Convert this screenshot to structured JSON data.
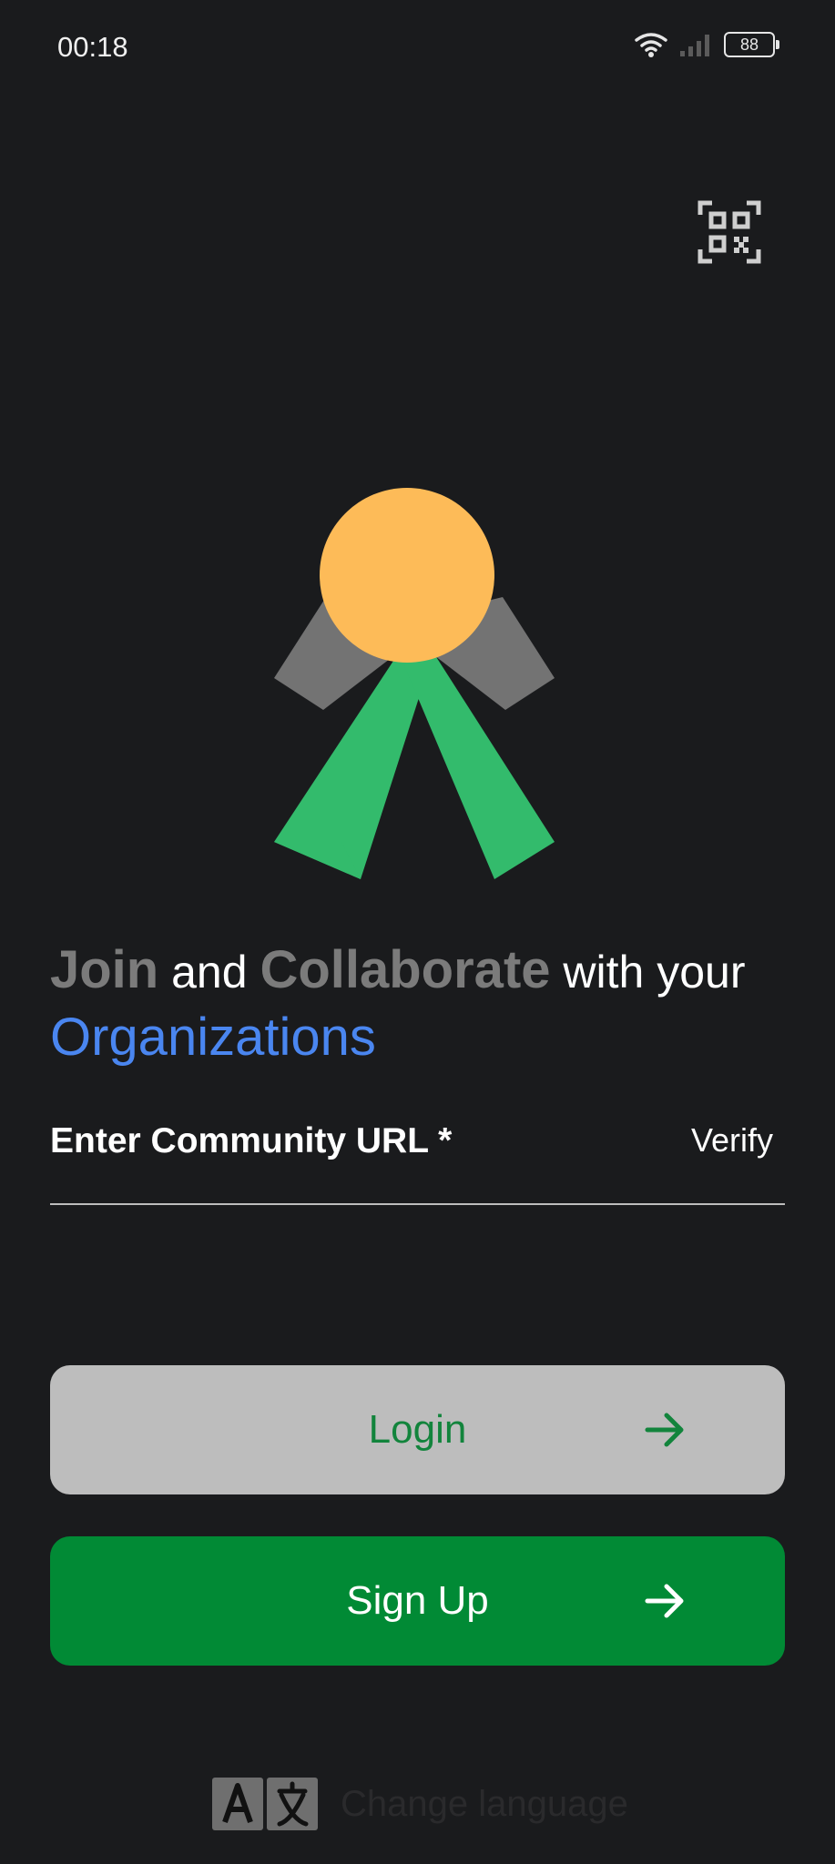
{
  "status_bar": {
    "time": "00:18",
    "battery": "88"
  },
  "headline": {
    "part1": "Join",
    "part2": " and ",
    "part3": "Collaborate",
    "part4": " with your",
    "part5": "Organizations"
  },
  "form": {
    "url_label": "Enter Community URL *",
    "verify_label": "Verify"
  },
  "buttons": {
    "login_label": "Login",
    "signup_label": "Sign Up"
  },
  "language": {
    "label": "Change language"
  },
  "colors": {
    "background": "#1a1b1d",
    "accent_green": "#018a35",
    "login_bg": "#bdbdbd",
    "link_blue": "#4a86f0",
    "logo_orange": "#fdbb58",
    "logo_green": "#33bb6c",
    "logo_gray": "#737373"
  },
  "icons": {
    "qr": "qr-code-icon",
    "wifi": "wifi-icon",
    "signal": "signal-icon",
    "battery": "battery-icon",
    "arrow": "arrow-right-icon",
    "translate": "translate-icon"
  }
}
